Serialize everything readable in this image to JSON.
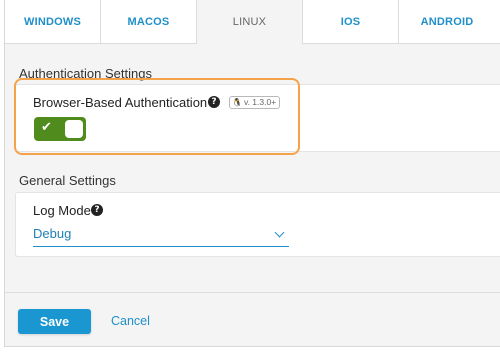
{
  "tabs": [
    {
      "label": "WINDOWS",
      "active": false
    },
    {
      "label": "MACOS",
      "active": false
    },
    {
      "label": "LINUX",
      "active": true
    },
    {
      "label": "IOS",
      "active": false
    },
    {
      "label": "ANDROID",
      "active": false
    }
  ],
  "authentication": {
    "section_title": "Authentication Settings",
    "setting_label": "Browser-Based Authentication",
    "help_icon": "question-circle-icon",
    "version_badge": "v. 1.3.0+",
    "platform_icon": "linux-icon",
    "toggle_on": true
  },
  "general": {
    "section_title": "General Settings",
    "log_mode_label": "Log Mode",
    "log_mode_value": "Debug"
  },
  "footer": {
    "save_label": "Save",
    "cancel_label": "Cancel"
  },
  "colors": {
    "accent": "#1a96d0",
    "toggle_on": "#4f8b1d",
    "highlight": "#f5a34a"
  }
}
